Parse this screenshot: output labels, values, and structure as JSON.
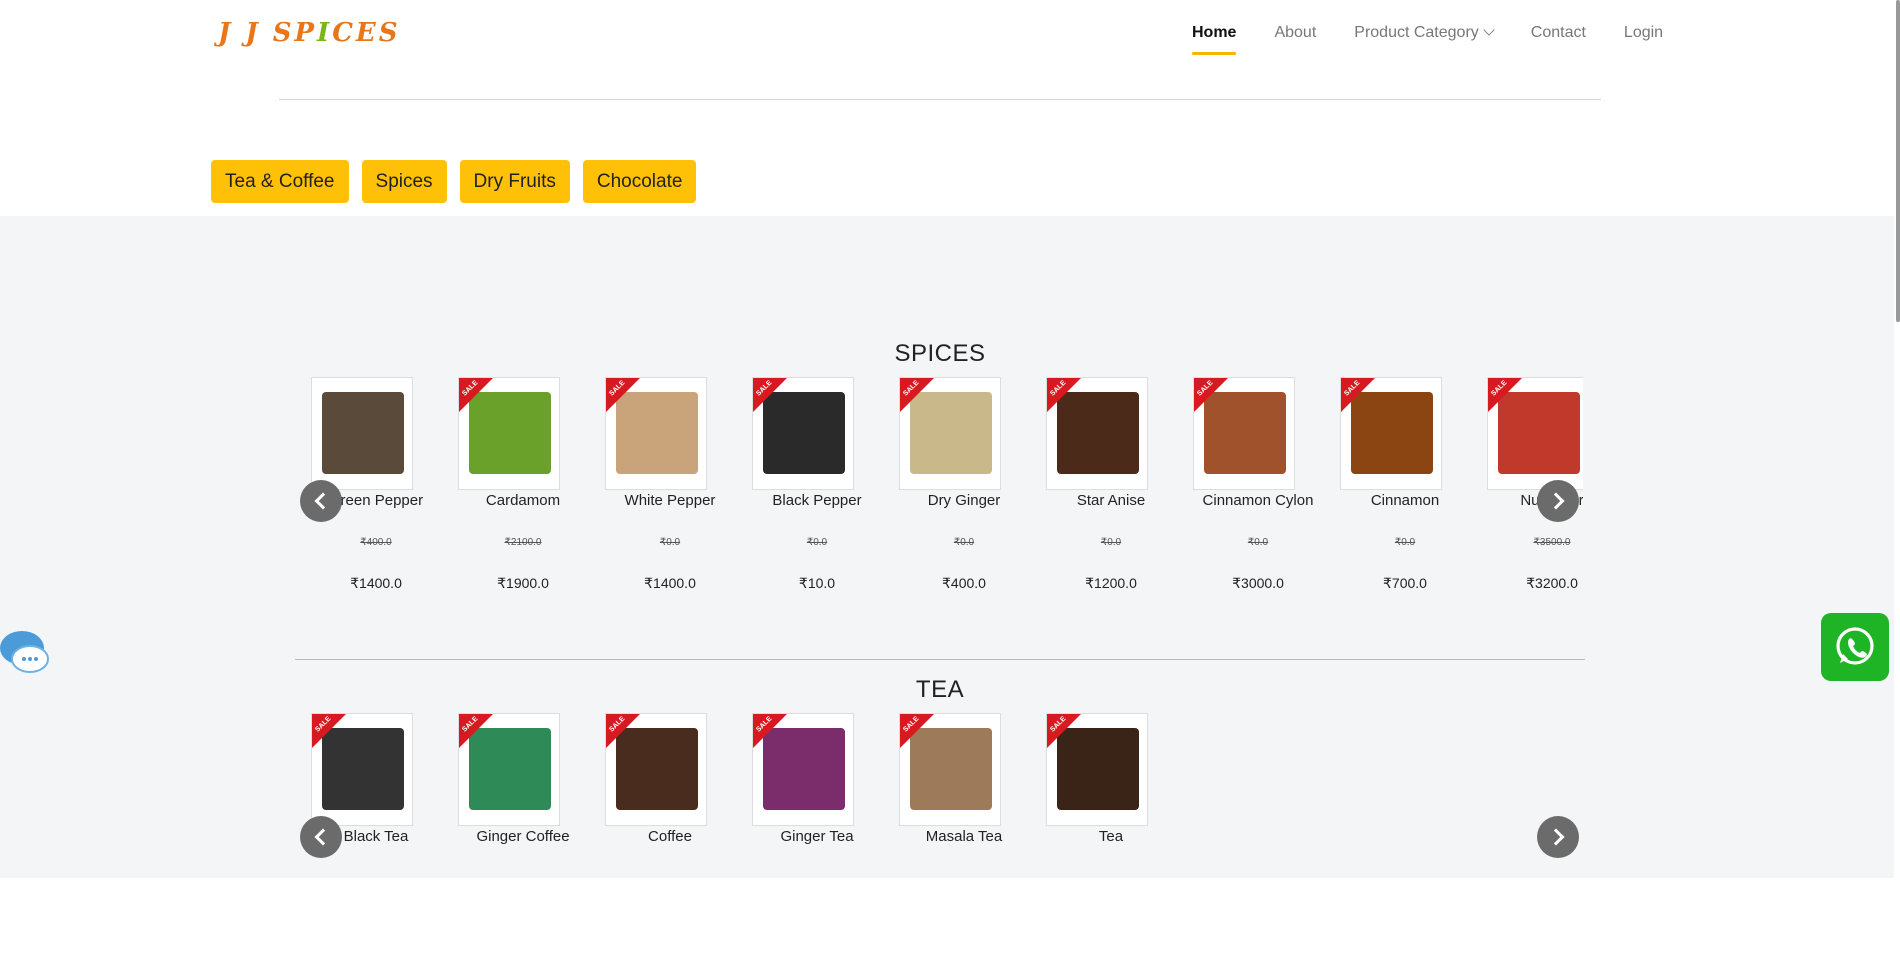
{
  "header": {
    "logo_left": "J J SP",
    "logo_mid": "I",
    "logo_right": "CES",
    "nav": [
      {
        "label": "Home",
        "active": true
      },
      {
        "label": "About",
        "active": false
      },
      {
        "label": "Product Category",
        "active": false
      },
      {
        "label": "Contact",
        "active": false
      },
      {
        "label": "Login",
        "active": false
      }
    ]
  },
  "categories": [
    "Tea & Coffee",
    "Spices",
    "Dry Fruits",
    "Chocolate"
  ],
  "sections": [
    {
      "title": "SPICES",
      "products": [
        {
          "name": "Green Pepper",
          "old_price": "₹400.0",
          "price": "₹1400.0",
          "sale": false,
          "color": "#5a4a3a"
        },
        {
          "name": "Cardamom",
          "old_price": "₹2100.0",
          "price": "₹1900.0",
          "sale": true,
          "color": "#6aa12a"
        },
        {
          "name": "White Pepper",
          "old_price": "₹0.0",
          "price": "₹1400.0",
          "sale": true,
          "color": "#c9a37a"
        },
        {
          "name": "Black Pepper",
          "old_price": "₹0.0",
          "price": "₹10.0",
          "sale": true,
          "color": "#2a2a2a"
        },
        {
          "name": "Dry Ginger",
          "old_price": "₹0.0",
          "price": "₹400.0",
          "sale": true,
          "color": "#c8b88a"
        },
        {
          "name": "Star Anise",
          "old_price": "₹0.0",
          "price": "₹1200.0",
          "sale": true,
          "color": "#4b2a1a"
        },
        {
          "name": "Cinnamon Cylon",
          "old_price": "₹0.0",
          "price": "₹3000.0",
          "sale": true,
          "color": "#a0522d"
        },
        {
          "name": "Cinnamon",
          "old_price": "₹0.0",
          "price": "₹700.0",
          "sale": true,
          "color": "#8b4513"
        },
        {
          "name": "Nutflower",
          "old_price": "₹3500.0",
          "price": "₹3200.0",
          "sale": true,
          "color": "#c0392b"
        }
      ]
    },
    {
      "title": "TEA",
      "products": [
        {
          "name": "Black Tea",
          "sale": true,
          "color": "#333333"
        },
        {
          "name": "Ginger Coffee",
          "sale": true,
          "color": "#2e8b57"
        },
        {
          "name": "Coffee",
          "sale": true,
          "color": "#4a2c1f"
        },
        {
          "name": "Ginger Tea",
          "sale": true,
          "color": "#7b2d6b"
        },
        {
          "name": "Masala Tea",
          "sale": true,
          "color": "#9c7a5a"
        },
        {
          "name": "Tea",
          "sale": true,
          "color": "#3a2418"
        }
      ]
    }
  ],
  "colors": {
    "accent": "#ffc107",
    "sale": "#d71920",
    "whatsapp": "#1fb425"
  },
  "sale_label": "SALE"
}
